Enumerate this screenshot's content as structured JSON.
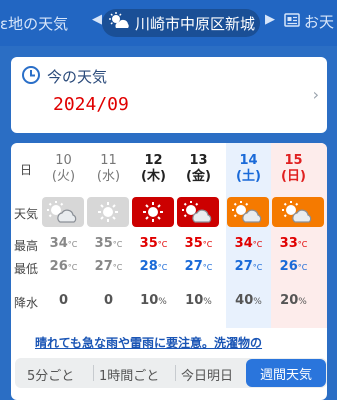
{
  "nav": {
    "prev_tab": "ε地の天気",
    "location": "川崎市中原区新城",
    "next_tab": "お天"
  },
  "today": {
    "title": "今の天気",
    "date": "2024/09"
  },
  "week": {
    "labels": {
      "day": "日",
      "weather": "天気",
      "high": "最高",
      "low": "最低",
      "rain": "降水"
    },
    "days": [
      {
        "num": "10",
        "wd": "(火)",
        "style": "past",
        "icon": "sun-cloud",
        "high": "34",
        "low": "26",
        "rain": "0",
        "rain_unit": ""
      },
      {
        "num": "11",
        "wd": "(水)",
        "style": "past",
        "icon": "sun",
        "high": "35",
        "low": "27",
        "rain": "0",
        "rain_unit": ""
      },
      {
        "num": "12",
        "wd": "(木)",
        "style": "normal",
        "icon": "sun",
        "high": "35",
        "low": "28",
        "rain": "10",
        "rain_unit": "%"
      },
      {
        "num": "13",
        "wd": "(金)",
        "style": "normal",
        "icon": "sun-cloud",
        "high": "35",
        "low": "27",
        "rain": "10",
        "rain_unit": "%"
      },
      {
        "num": "14",
        "wd": "(土)",
        "style": "sat",
        "icon": "sun-cloud",
        "high": "34",
        "low": "27",
        "rain": "40",
        "rain_unit": "%"
      },
      {
        "num": "15",
        "wd": "(日)",
        "style": "sun",
        "icon": "sun-cloud",
        "high": "33",
        "low": "26",
        "rain": "20",
        "rain_unit": "%"
      }
    ],
    "temp_unit": "°C",
    "notice": "晴れても急な雨や雷雨に要注意。洗濯物の"
  },
  "tabs": {
    "opt1": "5分ごと",
    "opt2": "1時間ごと",
    "opt3": "今日明日",
    "active": "週間天気"
  },
  "colors": {
    "hot_icon_bg": "#cc0000",
    "warm_icon_bg": "#f57a00",
    "past_icon_bg": "#d7d7d7",
    "high_temp": "#e00000",
    "low_temp": "#1a6ad8",
    "sat": "#1a6ad8",
    "sun": "#e02020"
  }
}
